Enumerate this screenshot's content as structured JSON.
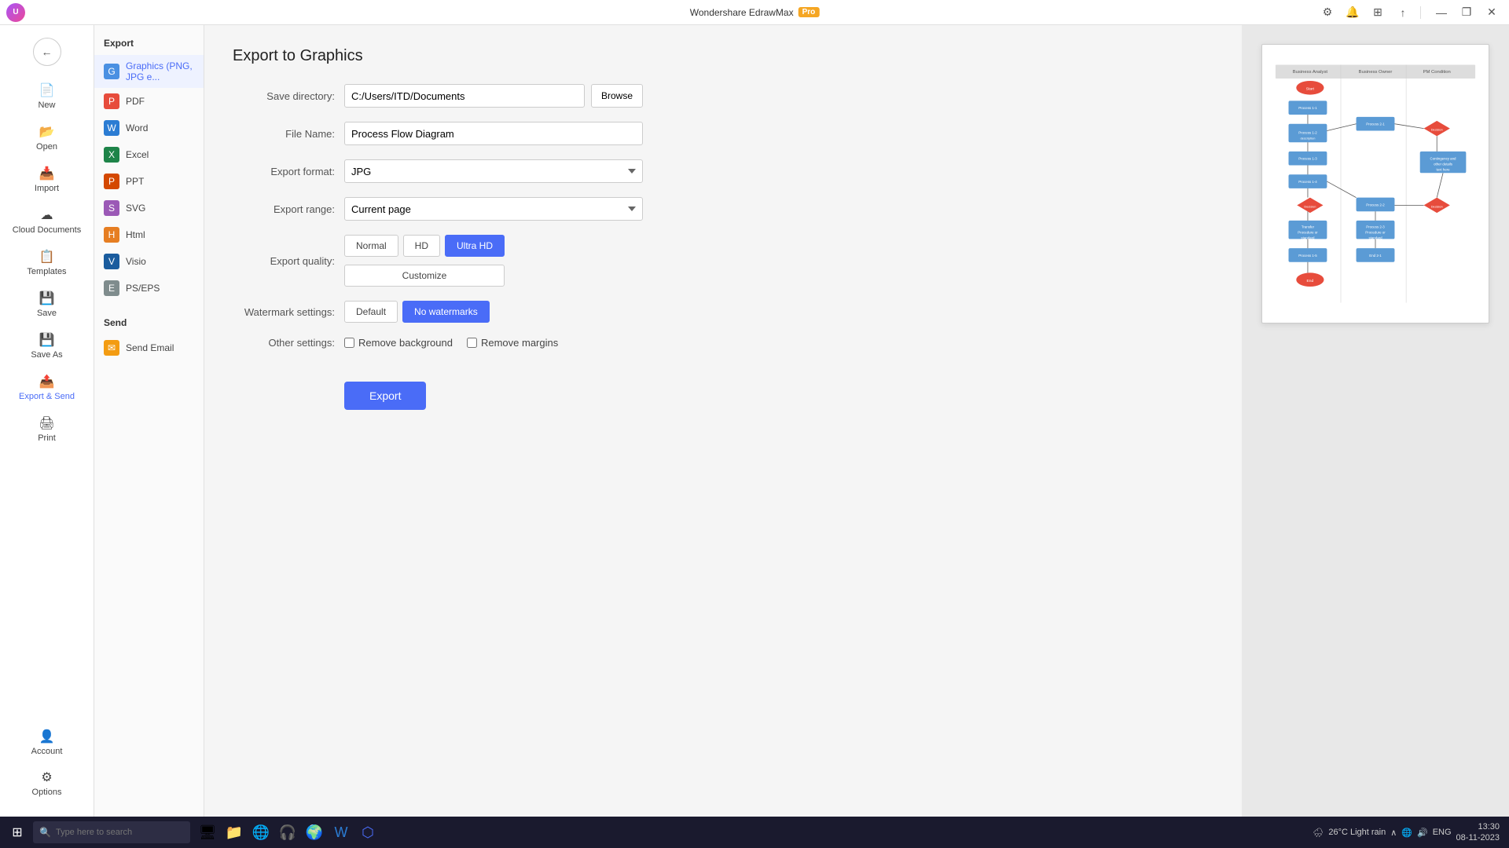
{
  "app": {
    "title": "Wondershare EdrawMax",
    "pro_label": "Pro"
  },
  "titlebar": {
    "minimize": "—",
    "restore": "❐",
    "close": "✕"
  },
  "nav": {
    "back_title": "Back",
    "items": [
      {
        "id": "new",
        "label": "New",
        "icon": "➕"
      },
      {
        "id": "open",
        "label": "Open",
        "icon": "📂"
      },
      {
        "id": "import",
        "label": "Import",
        "icon": "📥"
      },
      {
        "id": "cloud",
        "label": "Cloud Documents",
        "icon": "☁"
      },
      {
        "id": "templates",
        "label": "Templates",
        "icon": "📋"
      },
      {
        "id": "save",
        "label": "Save",
        "icon": "💾"
      },
      {
        "id": "saveas",
        "label": "Save As",
        "icon": "💾"
      },
      {
        "id": "export",
        "label": "Export & Send",
        "icon": "📤"
      },
      {
        "id": "print",
        "label": "Print",
        "icon": "🖨"
      }
    ],
    "bottom_items": [
      {
        "id": "account",
        "label": "Account",
        "icon": "👤"
      },
      {
        "id": "options",
        "label": "Options",
        "icon": "⚙"
      }
    ]
  },
  "sidebar": {
    "export_section": "Export",
    "items": [
      {
        "id": "graphics",
        "label": "Graphics (PNG, JPG e...",
        "icon": "G",
        "color": "icon-graphics",
        "active": true
      },
      {
        "id": "pdf",
        "label": "PDF",
        "icon": "P",
        "color": "icon-pdf"
      },
      {
        "id": "word",
        "label": "Word",
        "icon": "W",
        "color": "icon-word"
      },
      {
        "id": "excel",
        "label": "Excel",
        "icon": "X",
        "color": "icon-excel"
      },
      {
        "id": "ppt",
        "label": "PPT",
        "icon": "P",
        "color": "icon-ppt"
      },
      {
        "id": "svg",
        "label": "SVG",
        "icon": "S",
        "color": "icon-svg"
      },
      {
        "id": "html",
        "label": "Html",
        "icon": "H",
        "color": "icon-html"
      },
      {
        "id": "visio",
        "label": "Visio",
        "icon": "V",
        "color": "icon-visio"
      },
      {
        "id": "pseps",
        "label": "PS/EPS",
        "icon": "E",
        "color": "icon-pseps"
      }
    ],
    "send_section": "Send",
    "send_items": [
      {
        "id": "email",
        "label": "Send Email",
        "icon": "✉",
        "color": "icon-send"
      }
    ]
  },
  "export": {
    "page_title": "Export to Graphics",
    "save_directory_label": "Save directory:",
    "save_directory_value": "C:/Users/ITD/Documents",
    "browse_label": "Browse",
    "file_name_label": "File Name:",
    "file_name_value": "Process Flow Diagram",
    "export_format_label": "Export format:",
    "export_format_value": "JPG",
    "export_range_label": "Export range:",
    "export_range_value": "Current page",
    "export_quality_label": "Export quality:",
    "quality_options": [
      {
        "id": "normal",
        "label": "Normal",
        "active": false
      },
      {
        "id": "hd",
        "label": "HD",
        "active": false
      },
      {
        "id": "ultrahd",
        "label": "Ultra HD",
        "active": true
      }
    ],
    "customize_label": "Customize",
    "watermark_label": "Watermark settings:",
    "watermark_default": "Default",
    "watermark_none": "No watermarks",
    "other_settings_label": "Other settings:",
    "remove_background_label": "Remove background",
    "remove_margins_label": "Remove margins",
    "export_button": "Export"
  },
  "taskbar": {
    "search_placeholder": "Type here to search",
    "weather": "26°C  Light rain",
    "language": "ENG",
    "time": "13:30",
    "date": "08-11-2023"
  }
}
